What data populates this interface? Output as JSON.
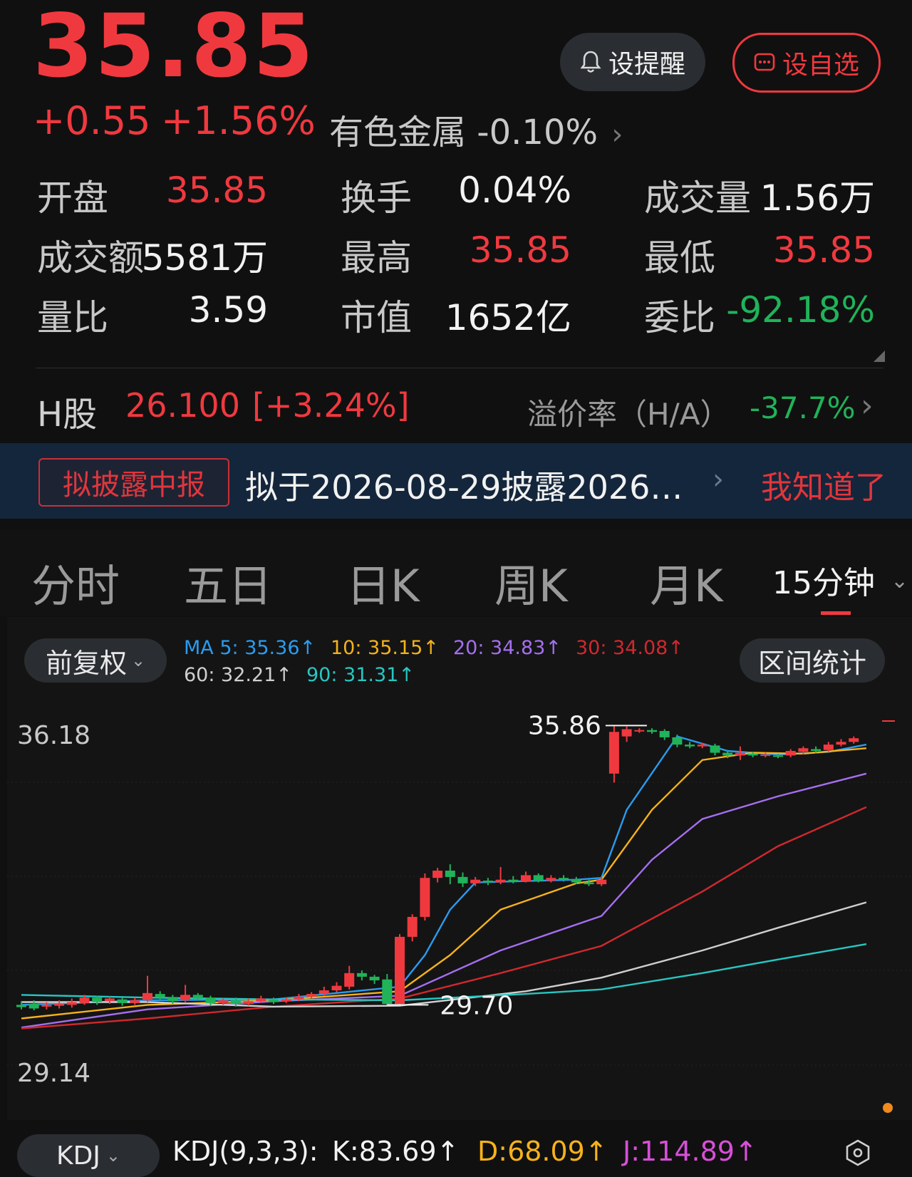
{
  "quote": {
    "price": "35.85",
    "change": "+0.55",
    "change_pct": "+1.56%",
    "sector_name": "有色金属",
    "sector_change": "-0.10%",
    "sector_arrow": "›"
  },
  "actions": {
    "remind_label": "设提醒",
    "favorite_label": "设自选"
  },
  "stats": {
    "open_label": "开盘",
    "open_value": "35.85",
    "turnover_label": "换手",
    "turnover_value": "0.04%",
    "volume_label": "成交量",
    "volume_value": "1.56万",
    "amount_label": "成交额",
    "amount_value": "5581万",
    "high_label": "最高",
    "high_value": "35.85",
    "low_label": "最低",
    "low_value": "35.85",
    "volume_ratio_label": "量比",
    "volume_ratio_value": "3.59",
    "market_cap_label": "市值",
    "market_cap_value": "1652亿",
    "order_ratio_label": "委比",
    "order_ratio_value": "-92.18%"
  },
  "hshare": {
    "label": "H股",
    "price": "26.100",
    "change": "[+3.24%]",
    "premium_label": "溢价率（H/A）",
    "premium_value": "-37.7%",
    "arrow": "›"
  },
  "notice": {
    "badge": "拟披露中报",
    "text": "拟于2026-08-29披露2026…",
    "arrow": "›",
    "ack": "我知道了"
  },
  "tabs": {
    "items": [
      "分时",
      "五日",
      "日K",
      "周K",
      "月K"
    ],
    "active": "15分钟",
    "active_arrow": "⌄"
  },
  "chart_controls": {
    "adjust_label": "前复权",
    "range_stats_label": "区间统计"
  },
  "ma_legend": {
    "ma5": "MA 5: 35.36↑",
    "ma10": "10: 35.15↑",
    "ma20": "20: 34.83↑",
    "ma30": "30: 34.08↑",
    "ma60": "60: 32.21↑",
    "ma90": "90: 31.31↑"
  },
  "colors": {
    "up": "#f0393f",
    "down": "#20b35a",
    "ma5": "#2a9cf0",
    "ma10": "#f5b21b",
    "ma20": "#a56ff0",
    "ma30": "#d0282e",
    "ma60": "#cfcfcf",
    "ma90": "#27c7c2"
  },
  "chart_data": {
    "type": "candlestick",
    "y_max_label": "36.18",
    "y_min_label": "29.14",
    "ylim": [
      29.14,
      36.18
    ],
    "high_marker": "35.86",
    "low_marker": "29.70",
    "candles": [
      {
        "o": 29.7,
        "c": 29.65,
        "h": 29.78,
        "l": 29.6
      },
      {
        "o": 29.72,
        "c": 29.62,
        "h": 29.8,
        "l": 29.58
      },
      {
        "o": 29.66,
        "c": 29.7,
        "h": 29.76,
        "l": 29.6
      },
      {
        "o": 29.68,
        "c": 29.72,
        "h": 29.8,
        "l": 29.62
      },
      {
        "o": 29.7,
        "c": 29.76,
        "h": 29.84,
        "l": 29.64
      },
      {
        "o": 29.74,
        "c": 29.86,
        "h": 29.92,
        "l": 29.7
      },
      {
        "o": 29.86,
        "c": 29.76,
        "h": 29.9,
        "l": 29.7
      },
      {
        "o": 29.78,
        "c": 29.84,
        "h": 29.88,
        "l": 29.72
      },
      {
        "o": 29.82,
        "c": 29.74,
        "h": 29.86,
        "l": 29.68
      },
      {
        "o": 29.74,
        "c": 29.8,
        "h": 29.86,
        "l": 29.7
      },
      {
        "o": 29.8,
        "c": 29.96,
        "h": 30.34,
        "l": 29.76
      },
      {
        "o": 29.94,
        "c": 29.86,
        "h": 30.0,
        "l": 29.8
      },
      {
        "o": 29.86,
        "c": 29.78,
        "h": 29.92,
        "l": 29.72
      },
      {
        "o": 29.8,
        "c": 29.92,
        "h": 30.14,
        "l": 29.76
      },
      {
        "o": 29.92,
        "c": 29.84,
        "h": 29.96,
        "l": 29.8
      },
      {
        "o": 29.86,
        "c": 29.74,
        "h": 29.9,
        "l": 29.68
      },
      {
        "o": 29.74,
        "c": 29.8,
        "h": 29.84,
        "l": 29.7
      },
      {
        "o": 29.8,
        "c": 29.72,
        "h": 29.86,
        "l": 29.66
      },
      {
        "o": 29.72,
        "c": 29.78,
        "h": 29.84,
        "l": 29.68
      },
      {
        "o": 29.78,
        "c": 29.84,
        "h": 29.9,
        "l": 29.74
      },
      {
        "o": 29.82,
        "c": 29.76,
        "h": 29.86,
        "l": 29.72
      },
      {
        "o": 29.78,
        "c": 29.82,
        "h": 29.86,
        "l": 29.74
      },
      {
        "o": 29.82,
        "c": 29.88,
        "h": 29.94,
        "l": 29.78
      },
      {
        "o": 29.88,
        "c": 29.94,
        "h": 29.98,
        "l": 29.84
      },
      {
        "o": 29.94,
        "c": 30.02,
        "h": 30.1,
        "l": 29.9
      },
      {
        "o": 30.02,
        "c": 30.12,
        "h": 30.2,
        "l": 29.98
      },
      {
        "o": 30.1,
        "c": 30.4,
        "h": 30.56,
        "l": 30.04
      },
      {
        "o": 30.4,
        "c": 30.32,
        "h": 30.46,
        "l": 30.24
      },
      {
        "o": 30.32,
        "c": 30.24,
        "h": 30.36,
        "l": 30.16
      },
      {
        "o": 30.26,
        "c": 29.72,
        "h": 30.38,
        "l": 29.7
      },
      {
        "o": 29.72,
        "c": 31.2,
        "h": 31.26,
        "l": 29.7
      },
      {
        "o": 31.2,
        "c": 31.64,
        "h": 31.7,
        "l": 31.1
      },
      {
        "o": 31.64,
        "c": 32.5,
        "h": 32.6,
        "l": 31.56
      },
      {
        "o": 32.5,
        "c": 32.66,
        "h": 32.72,
        "l": 32.4
      },
      {
        "o": 32.66,
        "c": 32.52,
        "h": 32.8,
        "l": 32.36
      },
      {
        "o": 32.52,
        "c": 32.38,
        "h": 32.62,
        "l": 32.3
      },
      {
        "o": 32.38,
        "c": 32.46,
        "h": 32.52,
        "l": 32.32
      },
      {
        "o": 32.44,
        "c": 32.4,
        "h": 32.5,
        "l": 32.34
      },
      {
        "o": 32.4,
        "c": 32.46,
        "h": 32.74,
        "l": 32.36
      },
      {
        "o": 32.46,
        "c": 32.42,
        "h": 32.54,
        "l": 32.38
      },
      {
        "o": 32.42,
        "c": 32.56,
        "h": 32.64,
        "l": 32.4
      },
      {
        "o": 32.56,
        "c": 32.44,
        "h": 32.6,
        "l": 32.4
      },
      {
        "o": 32.44,
        "c": 32.5,
        "h": 32.56,
        "l": 32.4
      },
      {
        "o": 32.5,
        "c": 32.46,
        "h": 32.56,
        "l": 32.42
      },
      {
        "o": 32.46,
        "c": 32.4,
        "h": 32.52,
        "l": 32.36
      },
      {
        "o": 32.4,
        "c": 32.36,
        "h": 32.46,
        "l": 32.32
      },
      {
        "o": 32.36,
        "c": 32.46,
        "h": 32.52,
        "l": 32.32
      },
      {
        "o": 34.8,
        "c": 35.72,
        "h": 35.86,
        "l": 34.6
      },
      {
        "o": 35.62,
        "c": 35.78,
        "h": 35.84,
        "l": 35.5
      },
      {
        "o": 35.74,
        "c": 35.76,
        "h": 35.8,
        "l": 35.7
      },
      {
        "o": 35.76,
        "c": 35.72,
        "h": 35.8,
        "l": 35.68
      },
      {
        "o": 35.74,
        "c": 35.6,
        "h": 35.78,
        "l": 35.54
      },
      {
        "o": 35.6,
        "c": 35.44,
        "h": 35.66,
        "l": 35.38
      },
      {
        "o": 35.44,
        "c": 35.4,
        "h": 35.5,
        "l": 35.36
      },
      {
        "o": 35.4,
        "c": 35.44,
        "h": 35.48,
        "l": 35.36
      },
      {
        "o": 35.42,
        "c": 35.26,
        "h": 35.46,
        "l": 35.2
      },
      {
        "o": 35.26,
        "c": 35.2,
        "h": 35.32,
        "l": 35.14
      },
      {
        "o": 35.2,
        "c": 35.26,
        "h": 35.4,
        "l": 35.1
      },
      {
        "o": 35.24,
        "c": 35.2,
        "h": 35.28,
        "l": 35.16
      },
      {
        "o": 35.2,
        "c": 35.22,
        "h": 35.26,
        "l": 35.16
      },
      {
        "o": 35.2,
        "c": 35.18,
        "h": 35.24,
        "l": 35.14
      },
      {
        "o": 35.2,
        "c": 35.3,
        "h": 35.34,
        "l": 35.16
      },
      {
        "o": 35.28,
        "c": 35.36,
        "h": 35.4,
        "l": 35.22
      },
      {
        "o": 35.34,
        "c": 35.3,
        "h": 35.4,
        "l": 35.26
      },
      {
        "o": 35.32,
        "c": 35.44,
        "h": 35.5,
        "l": 35.28
      },
      {
        "o": 35.44,
        "c": 35.5,
        "h": 35.56,
        "l": 35.4
      },
      {
        "o": 35.5,
        "c": 35.58,
        "h": 35.62,
        "l": 35.46
      }
    ],
    "ma_series": {
      "ma5": {
        "x": [
          0,
          10,
          20,
          30,
          32,
          34,
          36,
          44,
          46,
          48,
          52,
          56,
          60,
          64,
          67
        ],
        "y": [
          29.7,
          29.8,
          29.82,
          30.1,
          30.8,
          31.8,
          32.4,
          32.46,
          32.5,
          34.0,
          35.62,
          35.3,
          35.22,
          35.28,
          35.44
        ]
      },
      "ma10": {
        "x": [
          0,
          10,
          20,
          30,
          34,
          38,
          44,
          46,
          50,
          54,
          58,
          62,
          67
        ],
        "y": [
          29.4,
          29.7,
          29.8,
          30.0,
          30.8,
          31.8,
          32.38,
          32.46,
          34.0,
          35.1,
          35.26,
          35.24,
          35.36
        ]
      },
      "ma20": {
        "x": [
          0,
          10,
          20,
          30,
          38,
          46,
          50,
          54,
          60,
          67
        ],
        "y": [
          29.2,
          29.6,
          29.78,
          29.9,
          30.9,
          31.66,
          32.9,
          33.8,
          34.3,
          34.8
        ]
      },
      "ma30": {
        "x": [
          0,
          10,
          20,
          30,
          38,
          46,
          54,
          60,
          67
        ],
        "y": [
          29.18,
          29.4,
          29.66,
          29.84,
          30.4,
          31.0,
          32.2,
          33.2,
          34.06
        ]
      },
      "ma60": {
        "x": [
          0,
          10,
          20,
          30,
          40,
          46,
          54,
          60,
          67
        ],
        "y": [
          29.76,
          29.76,
          29.66,
          29.68,
          30.0,
          30.3,
          30.9,
          31.4,
          31.96
        ]
      },
      "ma90": {
        "x": [
          0,
          10,
          20,
          30,
          40,
          46,
          54,
          60,
          67
        ],
        "y": [
          29.92,
          29.86,
          29.82,
          29.8,
          29.94,
          30.04,
          30.4,
          30.7,
          31.04
        ]
      }
    }
  },
  "kdj": {
    "selector_label": "KDJ",
    "selector_arrow": "⌄",
    "params": "KDJ(9,3,3):",
    "k": "K:83.69↑",
    "d": "D:68.09↑",
    "j": "J:114.89↑"
  }
}
